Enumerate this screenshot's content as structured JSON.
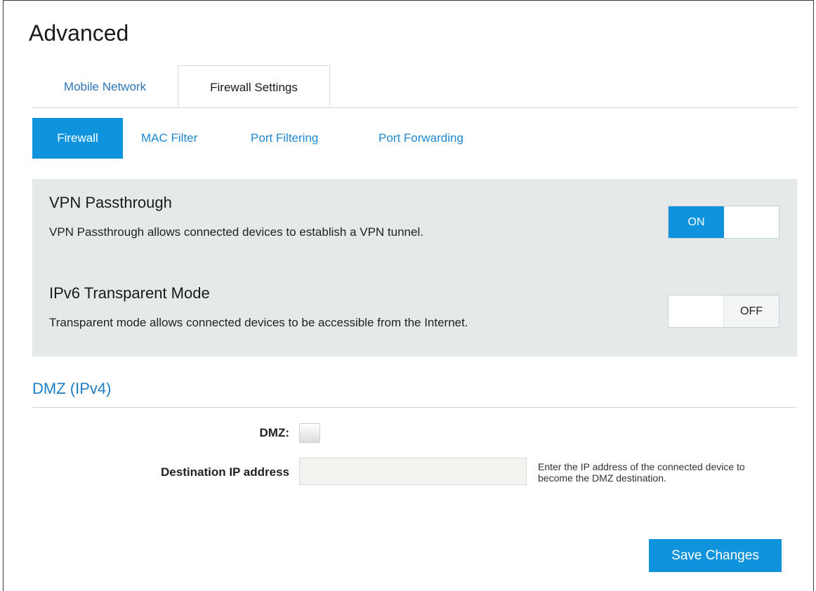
{
  "page": {
    "title": "Advanced"
  },
  "tabs": [
    {
      "label": "Mobile Network",
      "active": false
    },
    {
      "label": "Firewall Settings",
      "active": true
    }
  ],
  "subtabs": [
    {
      "label": "Firewall",
      "active": true
    },
    {
      "label": "MAC Filter",
      "active": false
    },
    {
      "label": "Port Filtering",
      "active": false
    },
    {
      "label": "Port Forwarding",
      "active": false
    }
  ],
  "options": {
    "vpn": {
      "title": "VPN Passthrough",
      "description": "VPN Passthrough allows connected devices to establish a VPN tunnel.",
      "state_label": "ON",
      "enabled": true
    },
    "ipv6": {
      "title": "IPv6 Transparent Mode",
      "description": "Transparent mode allows connected devices to be accessible from the Internet.",
      "state_label": "OFF",
      "enabled": false
    }
  },
  "dmz": {
    "section_title": "DMZ (IPv4)",
    "dmz_label": "DMZ:",
    "dmz_checked": false,
    "dest_label": "Destination IP address",
    "dest_value": "",
    "dest_placeholder": "",
    "help": "Enter the IP address of the connected device to become the DMZ destination."
  },
  "actions": {
    "save_label": "Save Changes"
  },
  "colors": {
    "accent": "#0f93dd",
    "link": "#1e88d0",
    "panel": "#e5e9ea"
  }
}
